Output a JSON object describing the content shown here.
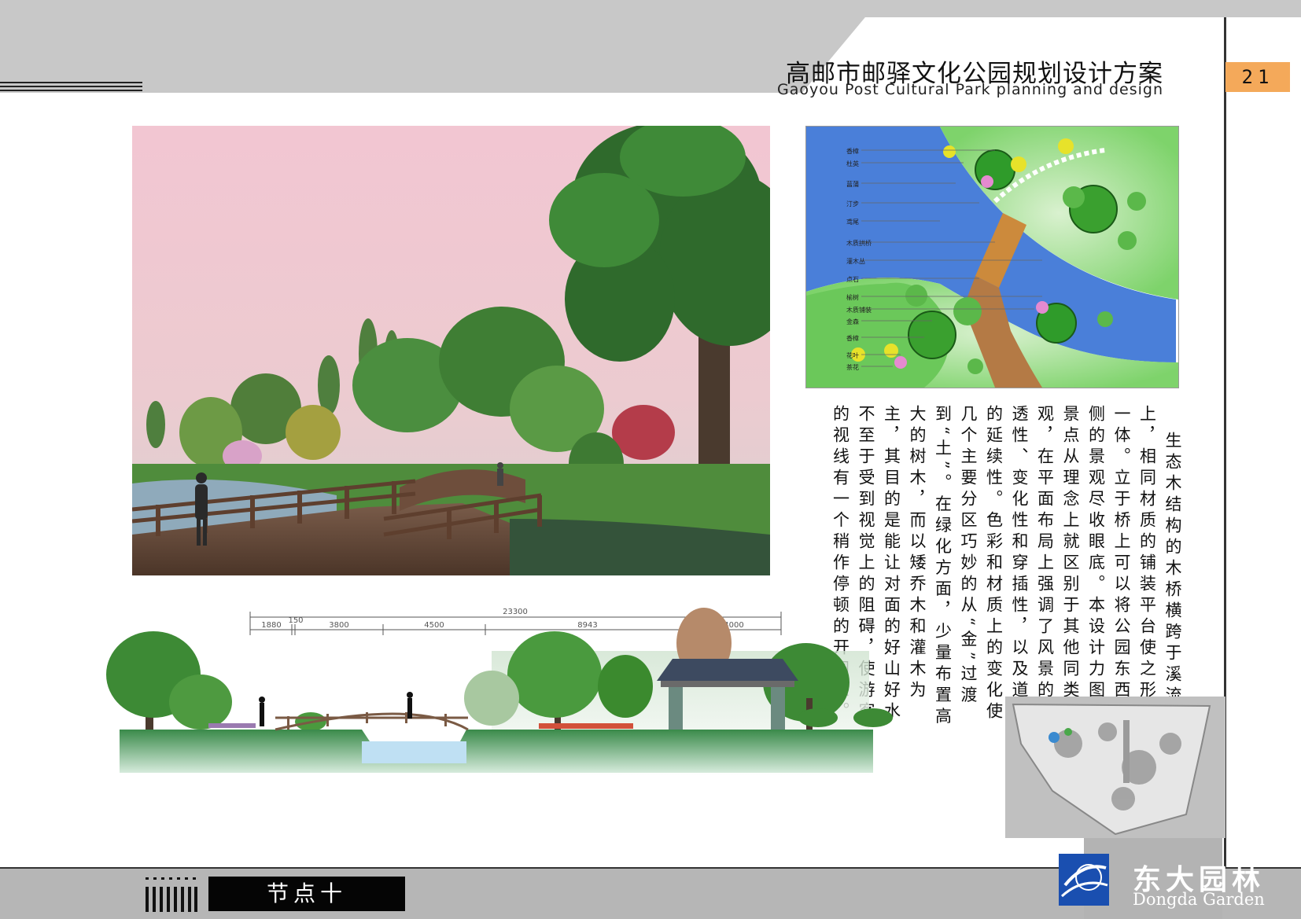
{
  "header": {
    "title_cn": "高邮市邮驿文化公园规划设计方案",
    "title_en": "Gaoyou Post Cultural Park planning and design",
    "page_number": "21"
  },
  "plan": {
    "labels": [
      "香樟",
      "杜英",
      "菖蒲",
      "汀步",
      "鸢尾",
      "木质拱桥",
      "灌木丛",
      "点石",
      "榆树",
      "木质铺装",
      "金森",
      "香樟",
      "花叶",
      "茶花"
    ]
  },
  "description": {
    "paragraphs": [
      "生态木结构的木桥横跨于溪流之上，相同材质的铺装平台使之形成一体。立于桥上可以将公园东西两侧的景观尽收眼底。本设计力图观景点从理念上就区别于其他同类景观，在平面布局上强调了风景的通透性、变化性和穿插性，以及道路的延续性。色彩和材质上的变化使几个主要分区巧妙的从“金”过渡到“土”。在绿化方面，少量布置高大的树木，而以矮乔木和灌木为主，其目的是能让对面的好山好水不至于受到视觉上的阻碍，使游客的视线有一个稍作停顿的开阔感。"
    ]
  },
  "elevation": {
    "total_dimension": "23300",
    "segment_dimensions": [
      "1880",
      "150",
      "3800",
      "4500",
      "8943",
      "4000"
    ]
  },
  "footer": {
    "node_label": "节点十",
    "brand_cn": "东大园林",
    "brand_en": "Dongda Garden"
  },
  "colors": {
    "accent_orange": "#f4a95a",
    "band_gray": "#c7c7c7",
    "water_blue": "#3a7fd6",
    "grass_green": "#5fbf5a"
  }
}
